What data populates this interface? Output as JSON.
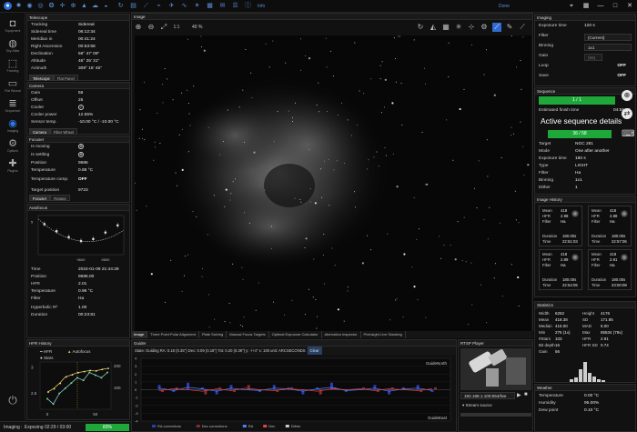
{
  "app": {
    "title": "Info",
    "window_buttons": {
      "minimize": "—",
      "maximize": "□",
      "close": "✕"
    },
    "toolbar_right": "Done"
  },
  "nav": {
    "items": [
      {
        "label": "Equipment",
        "icon": "camera-icon"
      },
      {
        "label": "Sky Atlas",
        "icon": "globe-icon"
      },
      {
        "label": "Framing",
        "icon": "frame-icon"
      },
      {
        "label": "Flat Wizard",
        "icon": "monitor-icon"
      },
      {
        "label": "Sequencer",
        "icon": "list-icon"
      },
      {
        "label": "Imaging",
        "icon": "aperture-icon"
      },
      {
        "label": "Options",
        "icon": "gear-icon"
      },
      {
        "label": "Plugins",
        "icon": "puzzle-icon"
      }
    ]
  },
  "telescope": {
    "title": "Telescope",
    "rows": [
      {
        "k": "Tracking",
        "v": "Sidereal"
      },
      {
        "k": "Sidereal time",
        "v": "06:12:34"
      },
      {
        "k": "Meridian in",
        "v": "00:41:24"
      },
      {
        "k": "Right Ascension",
        "v": "00:53:58"
      },
      {
        "k": "Declination",
        "v": "56° 47' 09\""
      },
      {
        "k": "Altitude",
        "v": "46° 25' 31\""
      },
      {
        "k": "Azimuth",
        "v": "309° 16' 45\""
      }
    ],
    "tabs": [
      "Telescope",
      "Flat Panel"
    ]
  },
  "camera": {
    "title": "Camera",
    "rows": [
      {
        "k": "Gain",
        "v": "56"
      },
      {
        "k": "Offset",
        "v": "25"
      },
      {
        "k": "Cooler",
        "v": "✓"
      },
      {
        "k": "Cooler power",
        "v": "12.55%"
      },
      {
        "k": "Sensor temp.",
        "v": "-10.00 °C / -10.00 °C"
      }
    ],
    "tabs": [
      "Camera",
      "Filter Wheel"
    ]
  },
  "focuser": {
    "title": "Focuser",
    "rows": [
      {
        "k": "Is moving",
        "v": "⊗"
      },
      {
        "k": "Is settling",
        "v": "⊗"
      },
      {
        "k": "Position",
        "v": "9686"
      },
      {
        "k": "Temperature",
        "v": "0.88 °C"
      },
      {
        "k": "Temperature comp.",
        "v": "OFF"
      },
      {
        "k": "Target position",
        "v": "9723"
      }
    ],
    "tabs": [
      "Focuser",
      "Rotator"
    ]
  },
  "autofocus": {
    "title": "Autofocus",
    "chart_data": {
      "type": "scatter",
      "x": [
        9300,
        9400,
        9500,
        9600,
        9700,
        9800,
        9900
      ],
      "values": [
        4.7,
        3.6,
        2.7,
        2.1,
        2.4,
        3.4,
        4.5
      ],
      "x_ticks": [
        "9600",
        "9800"
      ],
      "y_ticks": [
        "5"
      ],
      "xlim": [
        9250,
        9950
      ],
      "ylim": [
        0,
        6
      ]
    },
    "rows": [
      {
        "k": "Time",
        "v": "2024-01-09 21:44:28"
      },
      {
        "k": "Position",
        "v": "9686.00"
      },
      {
        "k": "HFR",
        "v": "2.01"
      },
      {
        "k": "Temperature",
        "v": "0.96 °C"
      },
      {
        "k": "Filter",
        "v": "Ha"
      },
      {
        "k": "Hyperbolic R²",
        "v": "1.00"
      },
      {
        "k": "Duration",
        "v": "00:23:81"
      }
    ]
  },
  "image": {
    "title": "Image",
    "zoom": "40 %"
  },
  "bottom_tabs": [
    "Image",
    "Three Point Polar Alignment",
    "Plate Solving",
    "Manual Focus Targets",
    "Optimal Exposure Calculator",
    "Aberration Inspector",
    "PixInsight Live Stacking"
  ],
  "hfr_history": {
    "title": "HFR History",
    "legend": [
      "HFR",
      "Stars",
      "Autofocus"
    ],
    "y_ticks": [
      "3",
      "2.5"
    ],
    "y2_ticks": [
      "200",
      "100"
    ],
    "x_ticks": [
      "0",
      "50"
    ],
    "chart_data": {
      "type": "line",
      "series": [
        {
          "name": "HFR",
          "values": [
            2.4,
            2.3,
            2.5,
            2.6,
            2.7,
            2.8,
            2.75,
            2.9,
            2.85,
            2.8,
            2.9
          ]
        },
        {
          "name": "Stars",
          "values": [
            80,
            95,
            120,
            150,
            160,
            170,
            175,
            180,
            178,
            185,
            190
          ]
        }
      ]
    }
  },
  "guider": {
    "title": "Guider",
    "header": "State: Guiding  RA: 0.18 (0.35\")  Dec: 0.09 (0.18\")  Tot: 0.20 (0.39\")  y: -/+4\"   x: 100   unit: ARCSECONDS",
    "clear": "Clear",
    "north": "GuideNorth",
    "east": "GuideEast",
    "legend": [
      "RA corrections",
      "Dec corrections",
      "RA",
      "Dec",
      "Dither"
    ],
    "y_ticks": [
      "4",
      "3",
      "2",
      "1",
      "0",
      "-1",
      "-2",
      "-3",
      "-4"
    ],
    "chart_data": {
      "type": "line",
      "series": [
        {
          "name": "RA",
          "values": [
            0.2,
            -0.1,
            0.3,
            0.1,
            -0.2,
            0.2,
            0.0,
            -0.1,
            0.2,
            0.1,
            -0.2,
            0.1,
            0.3,
            -0.1,
            0.0,
            0.2,
            -0.2,
            0.1,
            0.2,
            -0.1
          ]
        },
        {
          "name": "Dec",
          "values": [
            -0.1,
            0.1,
            0.0,
            -0.2,
            0.1,
            -0.1,
            0.2,
            0.0,
            -0.1,
            0.1,
            0.0,
            -0.2,
            0.1,
            0.0,
            0.1,
            -0.1,
            0.1,
            0.0,
            -0.1,
            0.1
          ]
        }
      ]
    }
  },
  "stream": {
    "title": "RTSP Player",
    "url": "192.168.1.100:554/live",
    "source": "Stream source"
  },
  "status": {
    "label": "Imaging",
    "text": "Exposing 02:29 / 03:00",
    "progress": 0.83,
    "progress_text": "83%"
  },
  "imaging": {
    "title": "Imaging",
    "rows": [
      {
        "k": "Exposure time",
        "v": "120 s"
      },
      {
        "k": "Filter",
        "v": "(Current)"
      },
      {
        "k": "Binning",
        "v": "1x1"
      },
      {
        "k": "Gain",
        "v": "(56)"
      },
      {
        "k": "Loop",
        "v": "OFF"
      },
      {
        "k": "Save",
        "v": "OFF"
      }
    ]
  },
  "sequence": {
    "title": "Sequence",
    "progress_text": "1 / 1",
    "finish_label": "Estimated finish time",
    "finish_time": "04:55:56",
    "active_label": "Active sequence details",
    "active_progress": "36 / 58",
    "rows": [
      {
        "k": "Target",
        "v": "NGC 281"
      },
      {
        "k": "Mode",
        "v": "One after another"
      },
      {
        "k": "Exposure time",
        "v": "180 s"
      },
      {
        "k": "Type",
        "v": "LIGHT"
      },
      {
        "k": "Filter",
        "v": "Ha"
      },
      {
        "k": "Binning",
        "v": "1x1"
      },
      {
        "k": "Dither",
        "v": "1"
      }
    ]
  },
  "image_history": {
    "title": "Image History",
    "cards": [
      {
        "Mean": "418",
        "HFR": "2.98",
        "Filter": "Ha",
        "Duration": "180.00s",
        "Time": "22:51:03"
      },
      {
        "Mean": "418",
        "HFR": "2.88",
        "Filter": "Ha",
        "Duration": "180.00s",
        "Time": "22:57:06"
      },
      {
        "Mean": "418",
        "HFR": "2.89",
        "Filter": "Ha",
        "Duration": "180.00s",
        "Time": "22:54:05"
      },
      {
        "Mean": "418",
        "HFR": "2.91",
        "Filter": "Ha",
        "Duration": "180.00s",
        "Time": "23:00:08"
      }
    ]
  },
  "statistics": {
    "title": "Statistics",
    "rows": [
      [
        "Width",
        "6252",
        "Height",
        "4176"
      ],
      [
        "Mean",
        "418.38",
        "SD",
        "171.85"
      ],
      [
        "Median",
        "415.00",
        "MAD",
        "5.00"
      ],
      [
        "Min",
        "275 (1x)",
        "Max",
        "65534 (79x)"
      ],
      [
        "#Stars",
        "103",
        "HFR",
        "2.91"
      ],
      [
        "Bit depth",
        "16",
        "HFR SD",
        "0.74"
      ],
      [
        "Gain",
        "56",
        "",
        ""
      ]
    ]
  },
  "weather": {
    "title": "Weather",
    "rows": [
      {
        "k": "Temperature",
        "v": "0.00 °C"
      },
      {
        "k": "Humidity",
        "v": "95.00%"
      },
      {
        "k": "Dew point",
        "v": "0.10 °C"
      }
    ]
  }
}
